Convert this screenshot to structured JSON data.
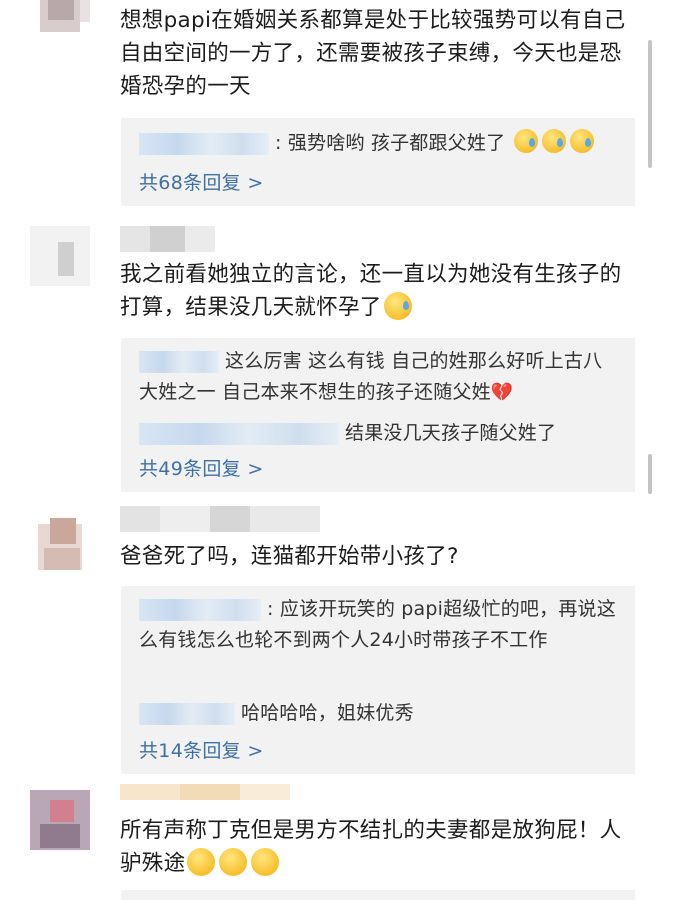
{
  "comments": [
    {
      "text": "想想papi在婚姻关系都算是处于比较强势可以有自己自由空间的一方了，还需要被孩子束缚，今天也是恐婚恐孕的一天",
      "replies": [
        {
          "text": "强势啥哟 孩子都跟父姓了",
          "emoji": [
            "crying-face-icon",
            "crying-face-icon",
            "crying-face-icon"
          ]
        }
      ],
      "more": "共68条回复 >"
    },
    {
      "text": "我之前看她独立的言论，还一直以为她没有生孩子的打算，结果没几天就怀孕了",
      "text_emoji": "sad-sweat-face-icon",
      "replies": [
        {
          "text": "这么厉害 这么有钱 自己的姓那么好听上古八大姓之一 自己本来不想生的孩子还随父姓",
          "emoji": [
            "broken-heart-icon"
          ]
        },
        {
          "text": "结果没几天孩子随父姓了"
        }
      ],
      "more": "共49条回复 >"
    },
    {
      "text": "爸爸死了吗，连猫都开始带小孩了?",
      "replies": [
        {
          "text": ": 应该开玩笑的 papi超级忙的吧，再说这么有钱怎么也轮不到两个人24小时带孩子不工作"
        },
        {
          "text": "哈哈哈哈，姐妹优秀"
        }
      ],
      "more": "共14条回复 >"
    },
    {
      "text": "所有声称丁克但是男方不结扎的夫妻都是放狗屁！人驴殊途",
      "text_emoji": [
        "thinking-face-icon",
        "thinking-face-icon",
        "thinking-face-icon"
      ]
    }
  ],
  "colors": {
    "link": "#3d6fa8",
    "reply_bg": "#f2f2f2",
    "text": "#1c1c1c"
  }
}
